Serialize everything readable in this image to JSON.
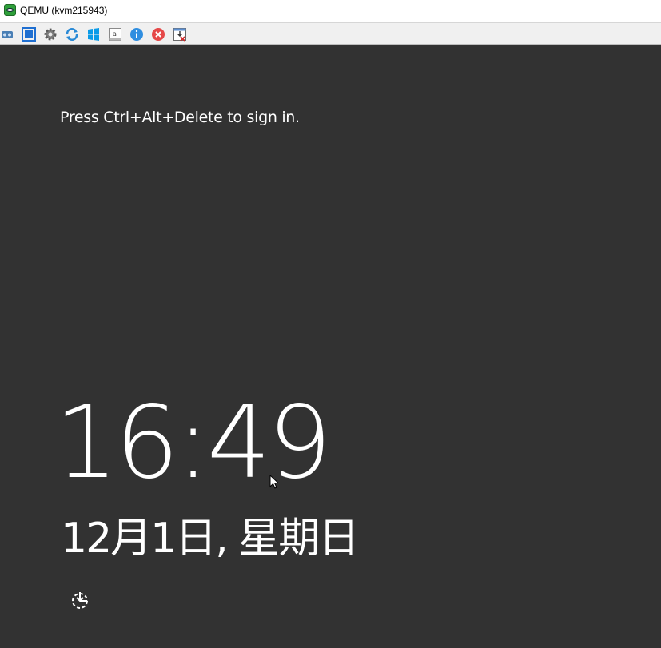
{
  "window": {
    "title": "QEMU (kvm215943)",
    "app_icon": "qemu-eye-icon"
  },
  "toolbar": {
    "buttons": [
      {
        "name": "network-icon",
        "color": "#4a7fb5"
      },
      {
        "name": "fullscreen-icon",
        "color": "#1f6fd1"
      },
      {
        "name": "settings-gear-icon",
        "color": "#7a7a7a"
      },
      {
        "name": "refresh-icon",
        "color": "#2a8ad6"
      },
      {
        "name": "windows-logo-icon",
        "color": "#0a9be8"
      },
      {
        "name": "text-input-icon",
        "color": "#555555"
      },
      {
        "name": "info-icon",
        "color": "#2f8ee0"
      },
      {
        "name": "close-red-icon",
        "color": "#e54848"
      },
      {
        "name": "disconnect-icon",
        "color": "#d22a2a"
      }
    ]
  },
  "lockscreen": {
    "signin_message": "Press Ctrl+Alt+Delete to sign in.",
    "time": "16:49",
    "date": "12月1日, 星期日",
    "background_color": "#323232",
    "ease_of_access_icon": "ease-of-access-icon"
  }
}
